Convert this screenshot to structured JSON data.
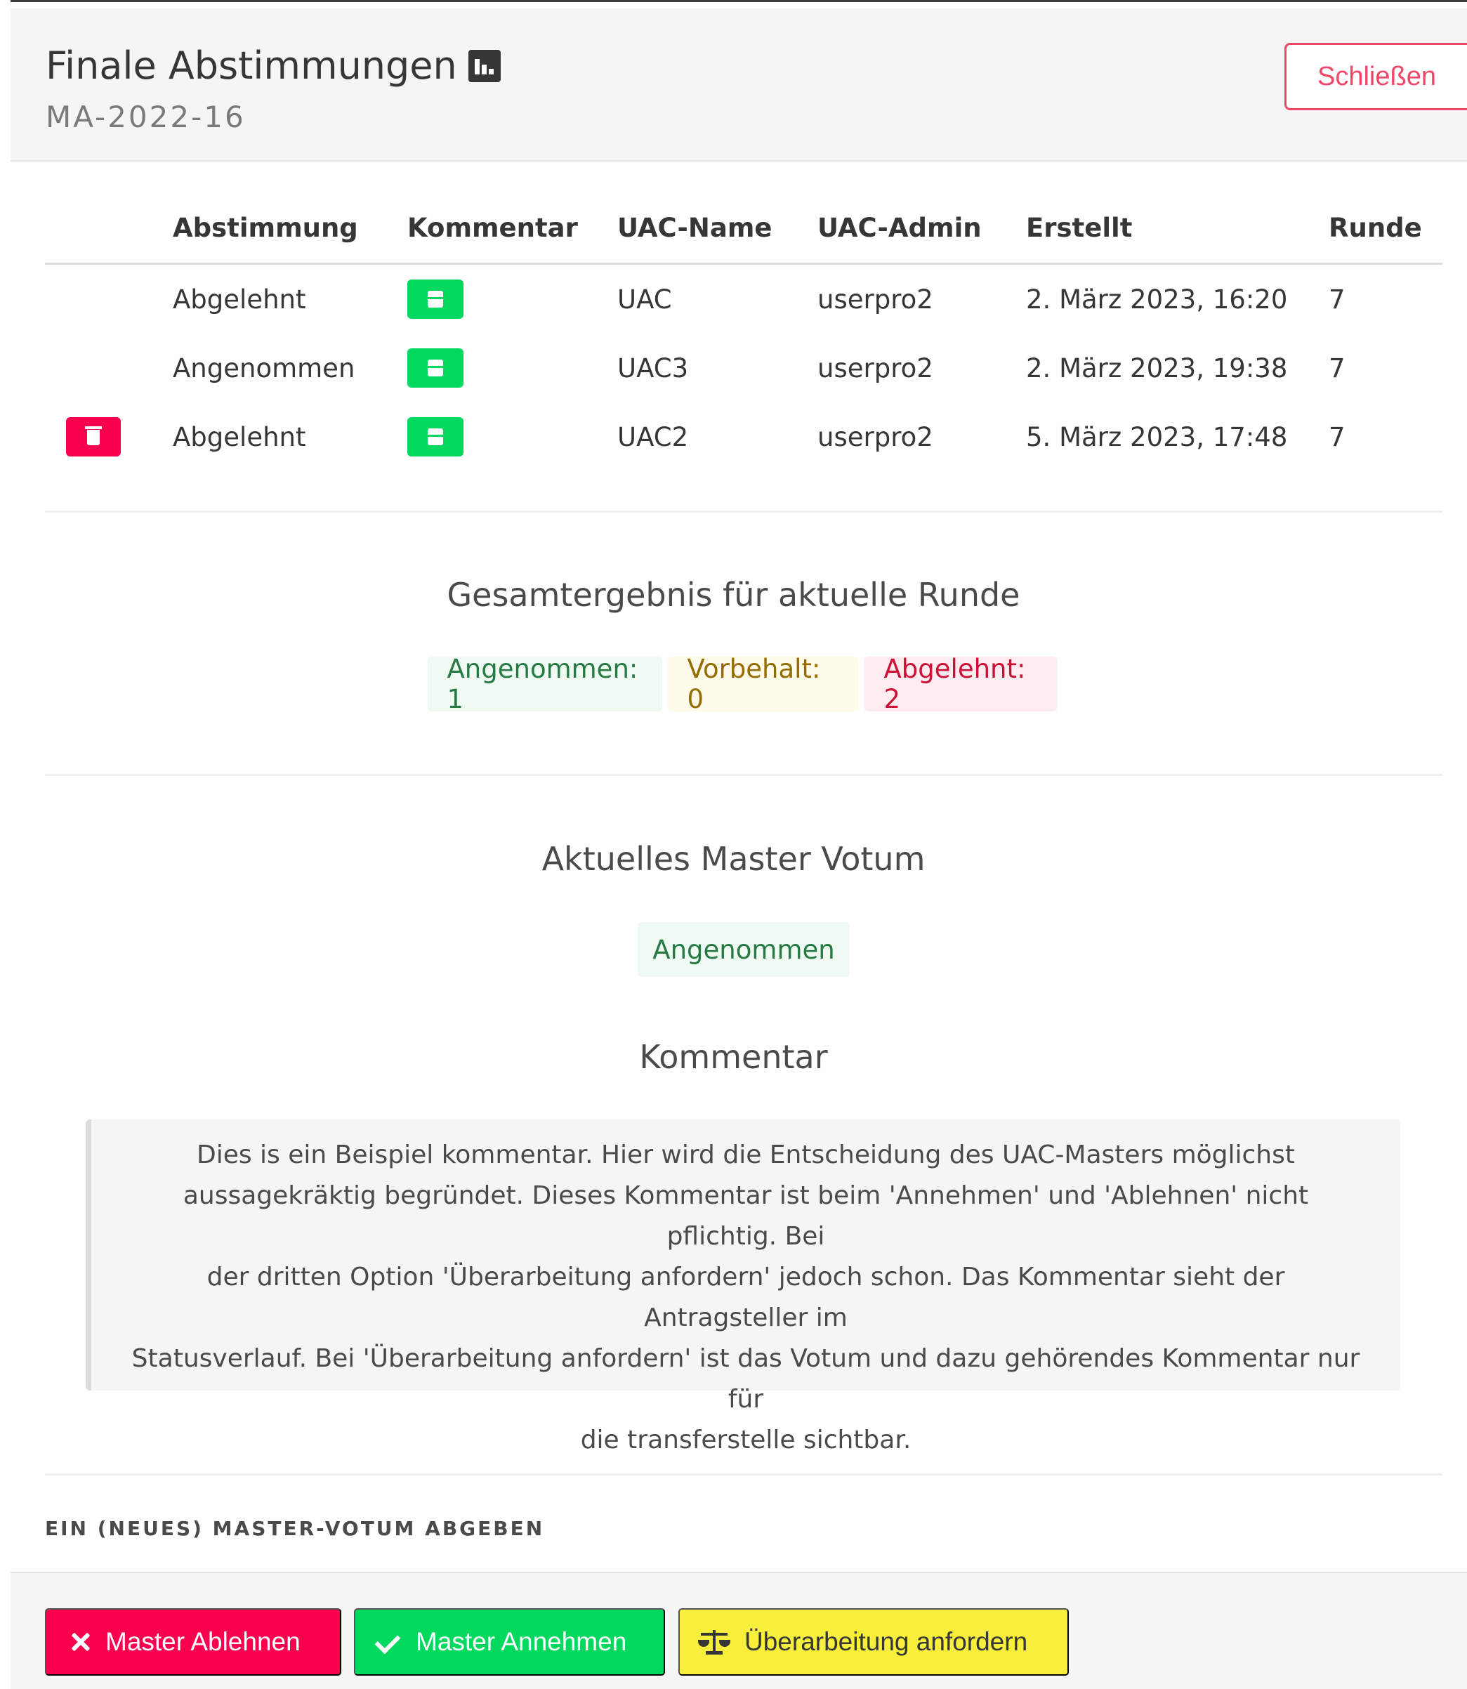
{
  "header": {
    "title": "Finale Abstimmungen",
    "subtitle": "MA-2022-16",
    "close_label": "Schließen",
    "title_icon": "bar-chart-icon"
  },
  "table": {
    "headers": [
      "Abstimmung",
      "Kommentar",
      "UAC-Name",
      "UAC-Admin",
      "Erstellt",
      "Runde"
    ],
    "rows": [
      {
        "vote": "Abgelehnt",
        "uac_name": "UAC",
        "uac_admin": "userpro2",
        "created": "2. März 2023, 16:20",
        "round": "7",
        "deletable": false
      },
      {
        "vote": "Angenommen",
        "uac_name": "UAC3",
        "uac_admin": "userpro2",
        "created": "2. März 2023, 19:38",
        "round": "7",
        "deletable": false
      },
      {
        "vote": "Abgelehnt",
        "uac_name": "UAC2",
        "uac_admin": "userpro2",
        "created": "5. März 2023, 17:48",
        "round": "7",
        "deletable": true
      }
    ]
  },
  "summary": {
    "title": "Gesamtergebnis für aktuelle Runde",
    "accepted": "Angenommen: 1",
    "reserved": "Vorbehalt: 0",
    "rejected": "Abgelehnt: 2"
  },
  "master": {
    "title": "Aktuelles Master Votum",
    "status": "Angenommen",
    "comment_title": "Kommentar",
    "comment_lines": [
      "Dies is ein Beispiel kommentar. Hier wird die Entscheidung des UAC-Masters möglichst",
      "aussagekräktig begründet. Dieses Kommentar ist beim 'Annehmen' und 'Ablehnen' nicht pflichtig. Bei",
      "der dritten Option 'Überarbeitung anfordern' jedoch schon. Das Kommentar sieht der Antragsteller im",
      "Statusverlauf. Bei 'Überarbeitung anfordern' ist das Votum und dazu gehörendes Kommentar nur für",
      "die transferstelle sichtbar."
    ]
  },
  "new_vote": {
    "label": "EIN (NEUES) MASTER-VOTUM ABGEBEN"
  },
  "footer": {
    "reject_label": "Master Ablehnen",
    "accept_label": "Master Annehmen",
    "revise_label": "Überarbeitung anfordern"
  },
  "colors": {
    "danger": "#f9004f",
    "success": "#00d85e",
    "warning": "#f8ef3c",
    "close_outline": "#f14668"
  }
}
